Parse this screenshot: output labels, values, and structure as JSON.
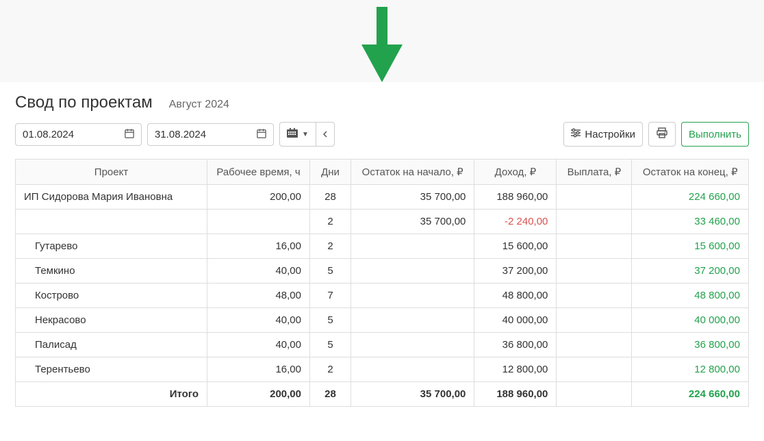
{
  "arrow_color": "#22a24d",
  "header": {
    "title": "Свод по проектам",
    "period_label": "Август 2024"
  },
  "toolbar": {
    "date_from": "01.08.2024",
    "date_to": "31.08.2024",
    "settings_label": "Настройки",
    "run_label": "Выполнить"
  },
  "table": {
    "columns": {
      "project": "Проект",
      "work_hours": "Рабочее время, ч",
      "days": "Дни",
      "start_balance": "Остаток на начало, ₽",
      "income": "Доход, ₽",
      "payout": "Выплата, ₽",
      "end_balance": "Остаток на конец, ₽"
    },
    "rows": [
      {
        "project": "ИП Сидорова Мария Ивановна",
        "indent": false,
        "work_hours": "200,00",
        "days": "28",
        "start_balance": "35 700,00",
        "income": "188 960,00",
        "income_class": "",
        "payout": "",
        "end_balance": "224 660,00"
      },
      {
        "project": "",
        "indent": true,
        "work_hours": "",
        "days": "2",
        "start_balance": "35 700,00",
        "income": "-2 240,00",
        "income_class": "neg",
        "payout": "",
        "end_balance": "33 460,00"
      },
      {
        "project": "Гутарево",
        "indent": true,
        "work_hours": "16,00",
        "days": "2",
        "start_balance": "",
        "income": "15 600,00",
        "income_class": "",
        "payout": "",
        "end_balance": "15 600,00"
      },
      {
        "project": "Темкино",
        "indent": true,
        "work_hours": "40,00",
        "days": "5",
        "start_balance": "",
        "income": "37 200,00",
        "income_class": "",
        "payout": "",
        "end_balance": "37 200,00"
      },
      {
        "project": "Кострово",
        "indent": true,
        "work_hours": "48,00",
        "days": "7",
        "start_balance": "",
        "income": "48 800,00",
        "income_class": "",
        "payout": "",
        "end_balance": "48 800,00"
      },
      {
        "project": "Некрасово",
        "indent": true,
        "work_hours": "40,00",
        "days": "5",
        "start_balance": "",
        "income": "40 000,00",
        "income_class": "",
        "payout": "",
        "end_balance": "40 000,00"
      },
      {
        "project": "Палисад",
        "indent": true,
        "work_hours": "40,00",
        "days": "5",
        "start_balance": "",
        "income": "36 800,00",
        "income_class": "",
        "payout": "",
        "end_balance": "36 800,00"
      },
      {
        "project": "Терентьево",
        "indent": true,
        "work_hours": "16,00",
        "days": "2",
        "start_balance": "",
        "income": "12 800,00",
        "income_class": "",
        "payout": "",
        "end_balance": "12 800,00"
      }
    ],
    "footer": {
      "label": "Итого",
      "work_hours": "200,00",
      "days": "28",
      "start_balance": "35 700,00",
      "income": "188 960,00",
      "payout": "",
      "end_balance": "224 660,00"
    }
  }
}
